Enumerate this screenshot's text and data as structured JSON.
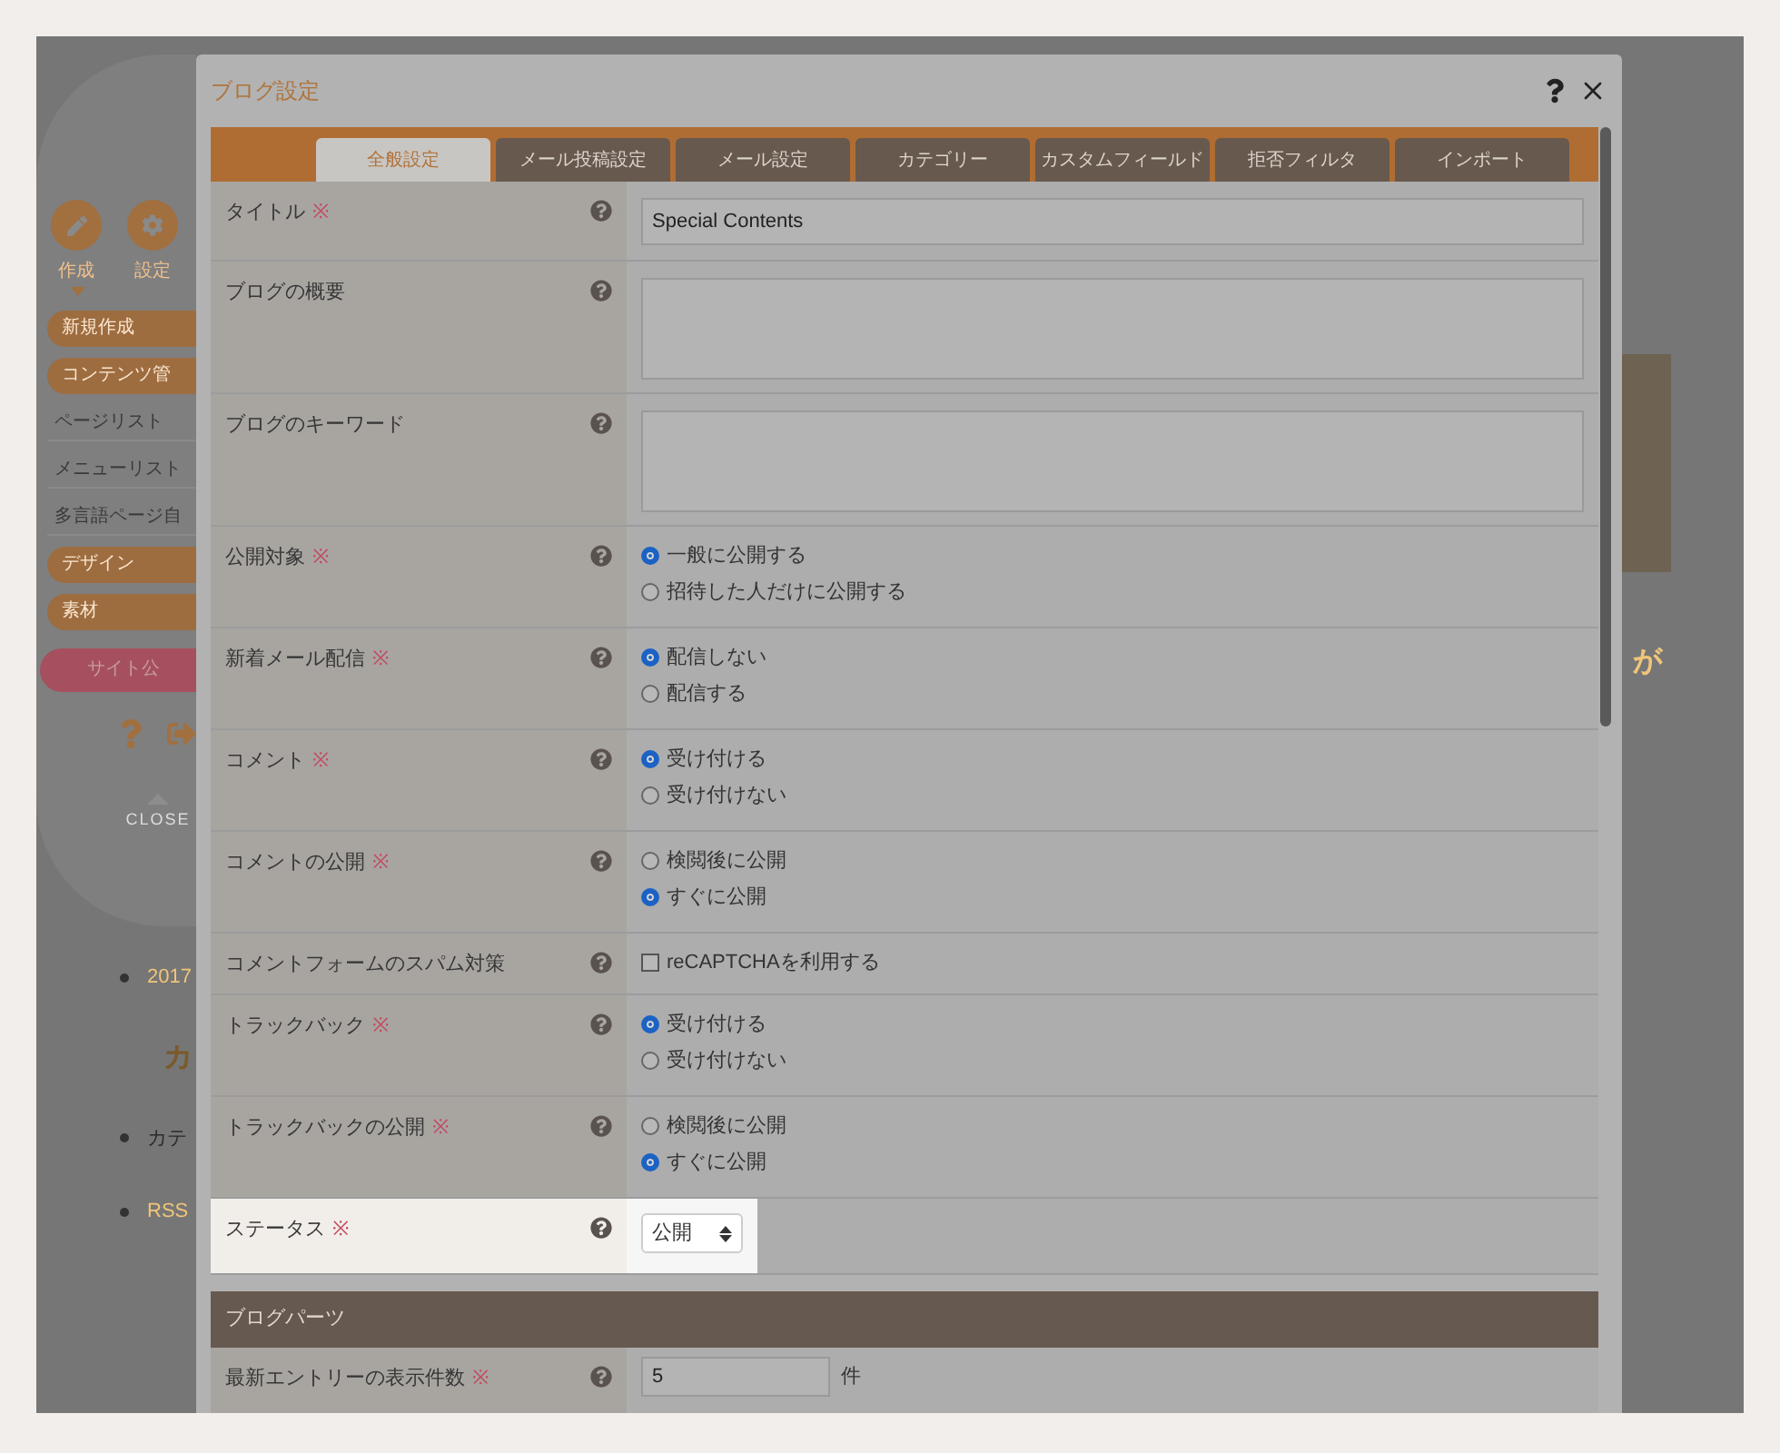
{
  "background": {
    "sidebar": {
      "tools": [
        {
          "label": "作成",
          "kind": "pen"
        },
        {
          "label": "設定",
          "kind": "gear"
        }
      ],
      "menu": [
        {
          "kind": "pill",
          "label": "新規作成"
        },
        {
          "kind": "pill",
          "label": "コンテンツ管"
        },
        {
          "kind": "link",
          "label": "ページリスト"
        },
        {
          "kind": "link",
          "label": "メニューリスト"
        },
        {
          "kind": "link",
          "label": "多言語ページ自"
        },
        {
          "kind": "pill",
          "label": "デザイン"
        },
        {
          "kind": "pill",
          "label": "素材"
        }
      ],
      "publish_button": "サイト公",
      "close_label": "CLOSE"
    },
    "content": [
      {
        "kind": "bullet",
        "text": "2017",
        "link": true
      },
      {
        "kind": "heading",
        "text": "カ"
      },
      {
        "kind": "bullet",
        "text": "カテ",
        "link": false
      },
      {
        "kind": "bullet",
        "text": "RSS",
        "link": true
      }
    ],
    "side_heading": "が"
  },
  "dialog": {
    "title": "ブログ設定",
    "tabs": [
      {
        "label": "全般設定",
        "selected": true
      },
      {
        "label": "メール投稿設定",
        "selected": false
      },
      {
        "label": "メール設定",
        "selected": false
      },
      {
        "label": "カテゴリー",
        "selected": false
      },
      {
        "label": "カスタムフィールド",
        "selected": false
      },
      {
        "label": "拒否フィルタ",
        "selected": false
      },
      {
        "label": "インポート",
        "selected": false
      }
    ],
    "fields": [
      {
        "kind": "text",
        "label": "タイトル",
        "mark": "※",
        "value": "Special Contents",
        "highlighted": false
      },
      {
        "kind": "textarea",
        "label": "ブログの概要",
        "highlighted": false
      },
      {
        "kind": "textarea",
        "label": "ブログのキーワード",
        "highlighted": false
      },
      {
        "kind": "radio",
        "label": "公開対象",
        "mark": "※",
        "highlighted": false,
        "options": [
          {
            "label": "一般に公開する",
            "selected": true
          },
          {
            "label": "招待した人だけに公開する",
            "selected": false
          }
        ]
      },
      {
        "kind": "radio",
        "label": "新着メール配信",
        "mark": "※",
        "highlighted": false,
        "options": [
          {
            "label": "配信しない",
            "selected": true
          },
          {
            "label": "配信する",
            "selected": false
          }
        ]
      },
      {
        "kind": "radio",
        "label": "コメント",
        "mark": "※",
        "highlighted": false,
        "options": [
          {
            "label": "受け付ける",
            "selected": true
          },
          {
            "label": "受け付けない",
            "selected": false
          }
        ]
      },
      {
        "kind": "radio",
        "label": "コメントの公開",
        "mark": "※",
        "highlighted": false,
        "options": [
          {
            "label": "検閲後に公開",
            "selected": false
          },
          {
            "label": "すぐに公開",
            "selected": true
          }
        ]
      },
      {
        "kind": "checkbox",
        "label": "コメントフォームのスパム対策",
        "highlighted": false,
        "option": {
          "label": "reCAPTCHAを利用する",
          "checked": false
        }
      },
      {
        "kind": "radio",
        "label": "トラックバック",
        "mark": "※",
        "highlighted": false,
        "options": [
          {
            "label": "受け付ける",
            "selected": true
          },
          {
            "label": "受け付けない",
            "selected": false
          }
        ]
      },
      {
        "kind": "radio",
        "label": "トラックバックの公開",
        "mark": "※",
        "highlighted": false,
        "options": [
          {
            "label": "検閲後に公開",
            "selected": false
          },
          {
            "label": "すぐに公開",
            "selected": true
          }
        ]
      },
      {
        "kind": "select",
        "label": "ステータス",
        "mark": "※",
        "highlighted": true,
        "value": "公開"
      }
    ],
    "section": {
      "title": "ブログパーツ",
      "fields": [
        {
          "kind": "number",
          "label": "最新エントリーの表示件数",
          "mark": "※",
          "highlighted": false,
          "value": "5",
          "unit": "件"
        }
      ]
    }
  }
}
